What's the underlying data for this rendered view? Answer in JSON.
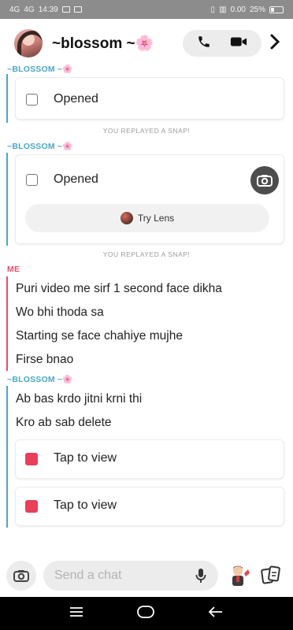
{
  "status_bar": {
    "network_1": "4G",
    "network_2": "4G",
    "time": "14:39",
    "battery": "25%",
    "speed": "0.00"
  },
  "header": {
    "contact_name": "~blossom ~",
    "flower_emoji": "🌸"
  },
  "messages": {
    "sender_blossom_1": "~BLOSSOM ~",
    "opened_1": "Opened",
    "system_1": "YOU REPLAYED A SNAP!",
    "sender_blossom_2": "~BLOSSOM ~",
    "opened_2": "Opened",
    "try_lens": "Try Lens",
    "system_2": "YOU REPLAYED A SNAP!",
    "sender_me": "ME",
    "me_lines": [
      "Puri video me sirf 1 second face dikha",
      "Wo bhi thoda sa",
      "Starting se face chahiye mujhe",
      "Firse bnao"
    ],
    "sender_blossom_3": "~BLOSSOM ~",
    "blossom_lines": [
      "Ab bas krdo jitni krni thi",
      "Kro ab sab delete"
    ],
    "tap_to_view_1": "Tap to view",
    "tap_to_view_2": "Tap to view"
  },
  "input": {
    "placeholder": "Send a chat"
  },
  "colors": {
    "blossom_accent": "#4aa8c7",
    "me_accent": "#e94e6d",
    "snap_red": "#ea3e5a"
  }
}
